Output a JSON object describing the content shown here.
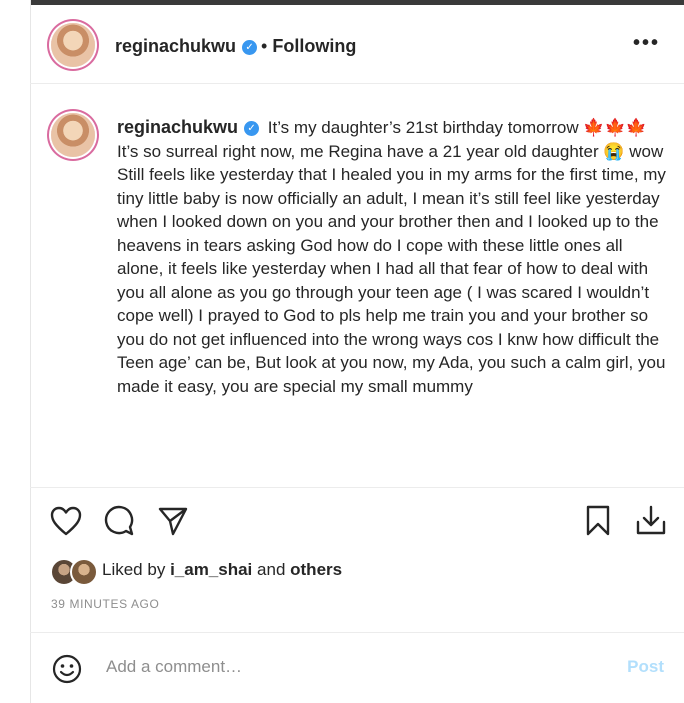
{
  "header": {
    "username": "reginachukwu",
    "separator": "•",
    "follow_status": "Following",
    "more_label": "•••"
  },
  "post": {
    "username": "reginachukwu",
    "verified": true,
    "caption_lines": [
      "It’s my daughter’s 21st birthday tomorrow 🍁🍁🍁",
      "It’s so surreal right now, me Regina have a 21 year old daughter 😭 wow",
      "Still feels like yesterday that I healed you in my arms for the first time, my tiny little baby is now officially an adult, I mean it’s still feel like yesterday when I looked down on you and your brother then and I looked up to the heavens in tears asking God how do I cope with these little ones all alone, it feels like yesterday when I had all that fear of how to deal with you all alone as you go through your teen age ( I was scared I wouldn’t cope well) I prayed to God to pls help me train you and your brother so you do not get influenced into the wrong ways cos I knw how difficult the Teen age’ can be, But look at you now, my Ada, you such a calm girl, you made it easy, you are special my small mummy"
    ]
  },
  "likes": {
    "prefix": "Liked by",
    "user": "i_am_shai",
    "conjunction": "and",
    "others": "others"
  },
  "timestamp": "39 MINUTES AGO",
  "comment": {
    "placeholder": "Add a comment…",
    "post_label": "Post"
  },
  "colors": {
    "verified_blue": "#3897f0",
    "post_button_disabled": "#b2dffc",
    "story_ring": "#d96b9f"
  },
  "icons": [
    "heart-icon",
    "comment-icon",
    "share-icon",
    "bookmark-icon",
    "download-icon",
    "emoji-icon",
    "verified-icon",
    "more-icon"
  ]
}
